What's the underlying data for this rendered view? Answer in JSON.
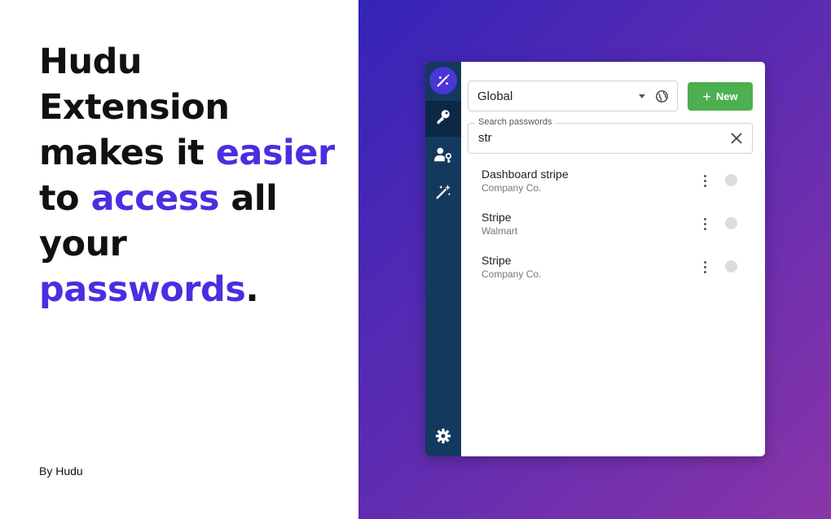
{
  "marketing": {
    "headline": {
      "line1": "Hudu",
      "line2": "Extension",
      "line3_pre": "makes it ",
      "line3_hl": "easier",
      "line4_pre": "to ",
      "line4_hl": "access",
      "line4_post": " all",
      "line5": "your",
      "line6_hl": "passwords",
      "line6_post": "."
    },
    "byline": "By Hudu"
  },
  "colors": {
    "highlight": "#4b2ee0",
    "rail": "#13395e",
    "new_button": "#4caf50",
    "gradient_start": "#3424b8",
    "gradient_end": "#8a35a8"
  },
  "sidebar": {
    "logo_icon": "magic-wand-icon",
    "items": [
      {
        "icon": "key-icon",
        "active": true
      },
      {
        "icon": "user-key-icon",
        "active": false
      },
      {
        "icon": "magic-sparkle-icon",
        "active": false
      }
    ],
    "bottom_icon": "gear-icon"
  },
  "toolbar": {
    "scope_value": "Global",
    "new_label": "New"
  },
  "search": {
    "label": "Search passwords",
    "value": "str"
  },
  "results": [
    {
      "title": "Dashboard stripe",
      "company": "Company Co."
    },
    {
      "title": "Stripe",
      "company": "Walmart"
    },
    {
      "title": "Stripe",
      "company": "Company Co."
    }
  ]
}
